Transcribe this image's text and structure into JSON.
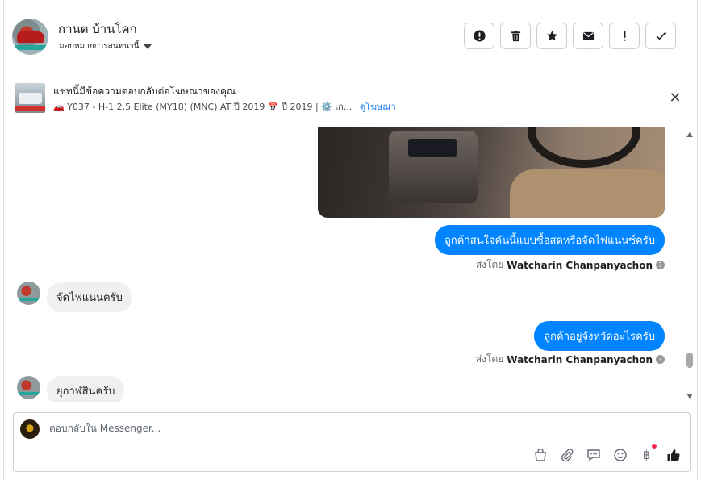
{
  "header": {
    "contact_name": "กานต บ้านโคก",
    "assign_label": "มอบหมายการสนทนานี้",
    "actions": [
      {
        "name": "alert-button",
        "icon": "exclamation-circle-icon"
      },
      {
        "name": "delete-button",
        "icon": "trash-icon"
      },
      {
        "name": "star-button",
        "icon": "star-icon"
      },
      {
        "name": "mark-unread-button",
        "icon": "envelope-icon"
      },
      {
        "name": "follow-up-button",
        "icon": "exclamation-icon"
      },
      {
        "name": "mark-done-button",
        "icon": "checkmark-icon"
      }
    ]
  },
  "ad": {
    "title": "แชทนี้มีข้อความตอบกลับต่อโฆษณาของคุณ",
    "subtitle": "🚗 Y037 - H-1 2.5 Elite (MY18) (MNC) AT ปี 2019 📅 ปี 2019 | ⚙️ เก...",
    "link": "ดูโฆษณา"
  },
  "messages": {
    "m1": {
      "text": "ลูกค้าสนใจคันนี้แบบซื้อสดหรือจัดไฟแนนซ์ครับ",
      "sent_by_prefix": "ส่งโดย",
      "sent_by_name": "Watcharin Chanpanyachon"
    },
    "m2": {
      "text": "จัดไฟแนนครับ"
    },
    "m3": {
      "text": "ลูกค้าอยู่จังหวัดอะไรครับ",
      "sent_by_prefix": "ส่งโดย",
      "sent_by_name": "Watcharin Chanpanyachon"
    },
    "m4": {
      "text": "ยุกาฬสินครับ"
    }
  },
  "composer": {
    "placeholder": "ตอบกลับใน Messenger..."
  },
  "colors": {
    "outgoing_bubble": "#0084ff",
    "incoming_bubble": "#f0f0f0",
    "link": "#1877f2"
  }
}
